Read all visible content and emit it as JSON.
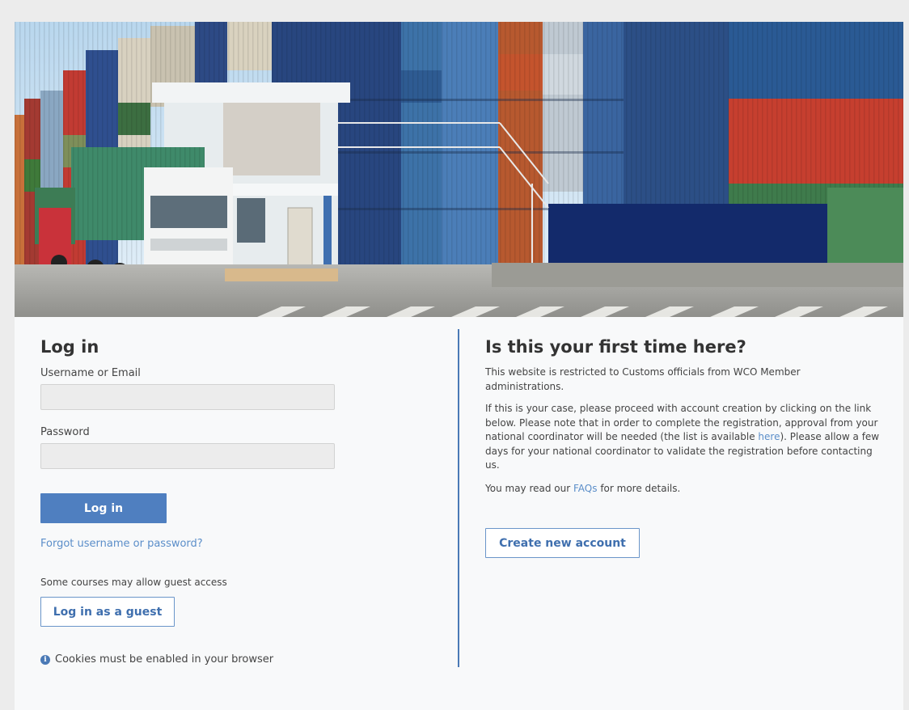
{
  "login": {
    "heading": "Log in",
    "username_label": "Username or Email",
    "username_value": "",
    "password_label": "Password",
    "password_value": "",
    "login_button": "Log in",
    "forgot_link": "Forgot username or password?",
    "guest_text": "Some courses may allow guest access",
    "guest_button": "Log in as a guest",
    "cookies_text": "Cookies must be enabled in your browser",
    "info_icon": "info-icon"
  },
  "signup": {
    "heading": "Is this your first time here?",
    "para1": "This website is restricted to Customs officials from WCO Member administrations.",
    "para2_before": "If this is your case, please proceed with account creation by clicking on the link below. Please note that in order to complete the registration, approval from your national coordinator will be needed (the list is available ",
    "para2_link": "here",
    "para2_after": "). Please allow a few days for your national coordinator to validate the registration before contacting us.",
    "para3_before": "You may read our ",
    "para3_link": "FAQs",
    "para3_after": " for more details.",
    "create_button": "Create new account"
  },
  "colors": {
    "accent": "#4f7fc0",
    "link": "#5b8ec9",
    "divider": "#4a79b6"
  }
}
